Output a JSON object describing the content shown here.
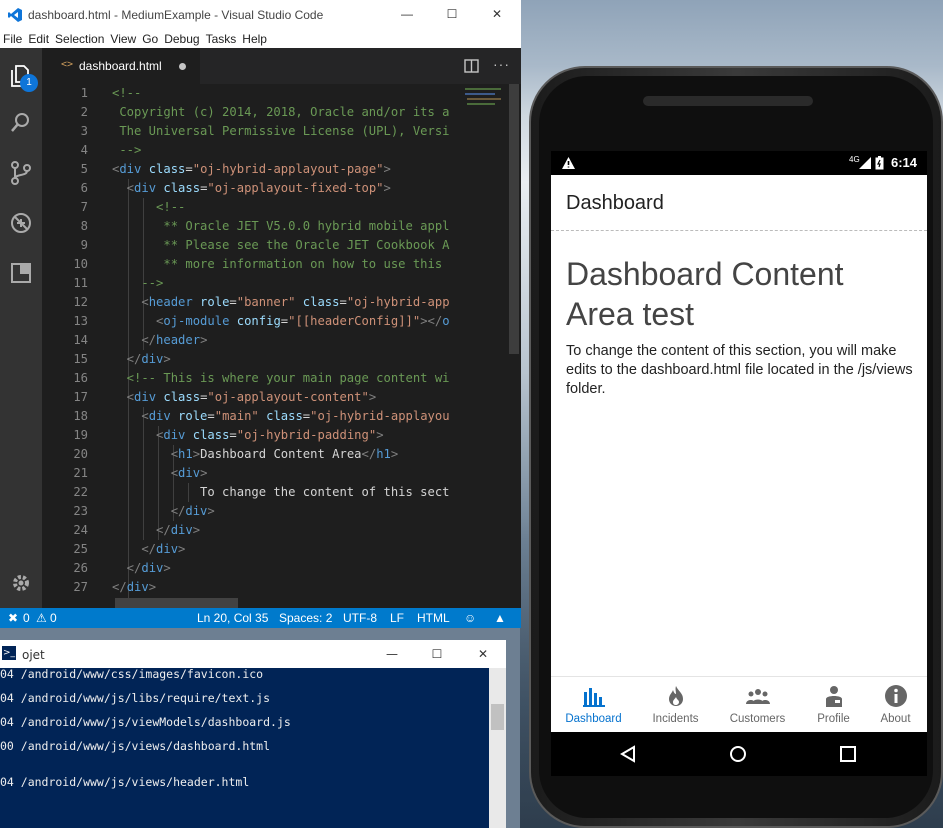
{
  "vscode": {
    "title": "dashboard.html - MediumExample - Visual Studio Code",
    "menu": [
      "File",
      "Edit",
      "Selection",
      "View",
      "Go",
      "Debug",
      "Tasks",
      "Help"
    ],
    "tab_label": "dashboard.html",
    "explorer_badge": "1",
    "lines": [
      {
        "n": "1",
        "parts": [
          [
            "cm",
            "<!--"
          ]
        ],
        "indent": 0
      },
      {
        "n": "2",
        "parts": [
          [
            "cm",
            " Copyright (c) 2014, 2018, Oracle and/or its a"
          ]
        ],
        "indent": 0
      },
      {
        "n": "3",
        "parts": [
          [
            "cm",
            " The Universal Permissive License (UPL), Versi"
          ]
        ],
        "indent": 0
      },
      {
        "n": "4",
        "parts": [
          [
            "cm",
            " -->"
          ]
        ],
        "indent": 0
      },
      {
        "n": "5",
        "parts": [
          [
            "pu",
            "<"
          ],
          [
            "tag",
            "div"
          ],
          [
            "at",
            " class"
          ],
          [
            "tx",
            "="
          ],
          [
            "st",
            "\"oj-hybrid-applayout-page\""
          ],
          [
            "pu",
            ">"
          ]
        ],
        "indent": 0
      },
      {
        "n": "6",
        "parts": [
          [
            "pu",
            "  <"
          ],
          [
            "tag",
            "div"
          ],
          [
            "at",
            " class"
          ],
          [
            "tx",
            "="
          ],
          [
            "st",
            "\"oj-applayout-fixed-top\""
          ],
          [
            "pu",
            ">"
          ]
        ],
        "indent": 0
      },
      {
        "n": "7",
        "parts": [
          [
            "cm",
            "      <!--"
          ]
        ],
        "indent": 0
      },
      {
        "n": "8",
        "parts": [
          [
            "cm",
            "       ** Oracle JET V5.0.0 hybrid mobile appl"
          ]
        ],
        "indent": 0
      },
      {
        "n": "9",
        "parts": [
          [
            "cm",
            "       ** Please see the Oracle JET Cookbook A"
          ]
        ],
        "indent": 0
      },
      {
        "n": "10",
        "parts": [
          [
            "cm",
            "       ** more information on how to use this"
          ]
        ],
        "indent": 0
      },
      {
        "n": "11",
        "parts": [
          [
            "cm",
            "    -->"
          ]
        ],
        "indent": 0
      },
      {
        "n": "12",
        "parts": [
          [
            "pu",
            "    <"
          ],
          [
            "tag",
            "header"
          ],
          [
            "at",
            " role"
          ],
          [
            "tx",
            "="
          ],
          [
            "st",
            "\"banner\""
          ],
          [
            "at",
            " class"
          ],
          [
            "tx",
            "="
          ],
          [
            "st",
            "\"oj-hybrid-app"
          ]
        ],
        "indent": 0
      },
      {
        "n": "13",
        "parts": [
          [
            "pu",
            "      <"
          ],
          [
            "tag",
            "oj-module"
          ],
          [
            "at",
            " config"
          ],
          [
            "tx",
            "="
          ],
          [
            "st",
            "\"[[headerConfig]]\""
          ],
          [
            "pu",
            "></"
          ],
          [
            "tag",
            "o"
          ]
        ],
        "indent": 0
      },
      {
        "n": "14",
        "parts": [
          [
            "pu",
            "    </"
          ],
          [
            "tag",
            "header"
          ],
          [
            "pu",
            ">"
          ]
        ],
        "indent": 0
      },
      {
        "n": "15",
        "parts": [
          [
            "pu",
            "  </"
          ],
          [
            "tag",
            "div"
          ],
          [
            "pu",
            ">"
          ]
        ],
        "indent": 0
      },
      {
        "n": "16",
        "parts": [
          [
            "cm",
            "  <!-- This is where your main page content wi"
          ]
        ],
        "indent": 0
      },
      {
        "n": "17",
        "parts": [
          [
            "pu",
            "  <"
          ],
          [
            "tag",
            "div"
          ],
          [
            "at",
            " class"
          ],
          [
            "tx",
            "="
          ],
          [
            "st",
            "\"oj-applayout-content\""
          ],
          [
            "pu",
            ">"
          ]
        ],
        "indent": 0
      },
      {
        "n": "18",
        "parts": [
          [
            "pu",
            "    <"
          ],
          [
            "tag",
            "div"
          ],
          [
            "at",
            " role"
          ],
          [
            "tx",
            "="
          ],
          [
            "st",
            "\"main\""
          ],
          [
            "at",
            " class"
          ],
          [
            "tx",
            "="
          ],
          [
            "st",
            "\"oj-hybrid-applayou"
          ]
        ],
        "indent": 0
      },
      {
        "n": "19",
        "parts": [
          [
            "pu",
            "      <"
          ],
          [
            "tag",
            "div"
          ],
          [
            "at",
            " class"
          ],
          [
            "tx",
            "="
          ],
          [
            "st",
            "\"oj-hybrid-padding\""
          ],
          [
            "pu",
            ">"
          ]
        ],
        "indent": 0
      },
      {
        "n": "20",
        "parts": [
          [
            "pu",
            "        <"
          ],
          [
            "tag",
            "h1"
          ],
          [
            "pu",
            ">"
          ],
          [
            "tx",
            "Dashboard Content Area"
          ],
          [
            "pu",
            "</"
          ],
          [
            "tag",
            "h1"
          ],
          [
            "pu",
            ">"
          ]
        ],
        "indent": 0
      },
      {
        "n": "21",
        "parts": [
          [
            "pu",
            "        <"
          ],
          [
            "tag",
            "div"
          ],
          [
            "pu",
            ">"
          ]
        ],
        "indent": 0
      },
      {
        "n": "22",
        "parts": [
          [
            "tx",
            "            To change the content of this sect"
          ]
        ],
        "indent": 0
      },
      {
        "n": "23",
        "parts": [
          [
            "pu",
            "        </"
          ],
          [
            "tag",
            "div"
          ],
          [
            "pu",
            ">"
          ]
        ],
        "indent": 0
      },
      {
        "n": "24",
        "parts": [
          [
            "pu",
            "      </"
          ],
          [
            "tag",
            "div"
          ],
          [
            "pu",
            ">"
          ]
        ],
        "indent": 0
      },
      {
        "n": "25",
        "parts": [
          [
            "pu",
            "    </"
          ],
          [
            "tag",
            "div"
          ],
          [
            "pu",
            ">"
          ]
        ],
        "indent": 0
      },
      {
        "n": "26",
        "parts": [
          [
            "pu",
            "  </"
          ],
          [
            "tag",
            "div"
          ],
          [
            "pu",
            ">"
          ]
        ],
        "indent": 0
      },
      {
        "n": "27",
        "parts": [
          [
            "pu",
            "</"
          ],
          [
            "tag",
            "div"
          ],
          [
            "pu",
            ">"
          ]
        ],
        "indent": 0
      }
    ],
    "status": {
      "errors": "0",
      "warnings": "0",
      "position": "Ln 20, Col 35",
      "spaces": "Spaces: 2",
      "encoding": "UTF-8",
      "eol": "LF",
      "language": "HTML"
    }
  },
  "terminal": {
    "title": "ojet",
    "lines": [
      "04 /android/www/css/images/favicon.ico",
      "04 /android/www/js/libs/require/text.js",
      "04 /android/www/js/viewModels/dashboard.js",
      "00 /android/www/js/views/dashboard.html",
      "",
      "04 /android/www/js/views/header.html"
    ]
  },
  "phone": {
    "status_network": "4G",
    "status_time": "6:14",
    "header_title": "Dashboard",
    "heading": "Dashboard Content Area test",
    "paragraph": "To change the content of this section, you will make edits to the dashboard.html file located in the /js/views folder.",
    "nav": [
      {
        "label": "Dashboard",
        "icon": "bar-chart-icon",
        "selected": true
      },
      {
        "label": "Incidents",
        "icon": "fire-icon",
        "selected": false
      },
      {
        "label": "Customers",
        "icon": "people-icon",
        "selected": false
      },
      {
        "label": "Profile",
        "icon": "person-icon",
        "selected": false
      },
      {
        "label": "About",
        "icon": "info-icon",
        "selected": false
      }
    ],
    "accent_color": "#0572ce"
  }
}
